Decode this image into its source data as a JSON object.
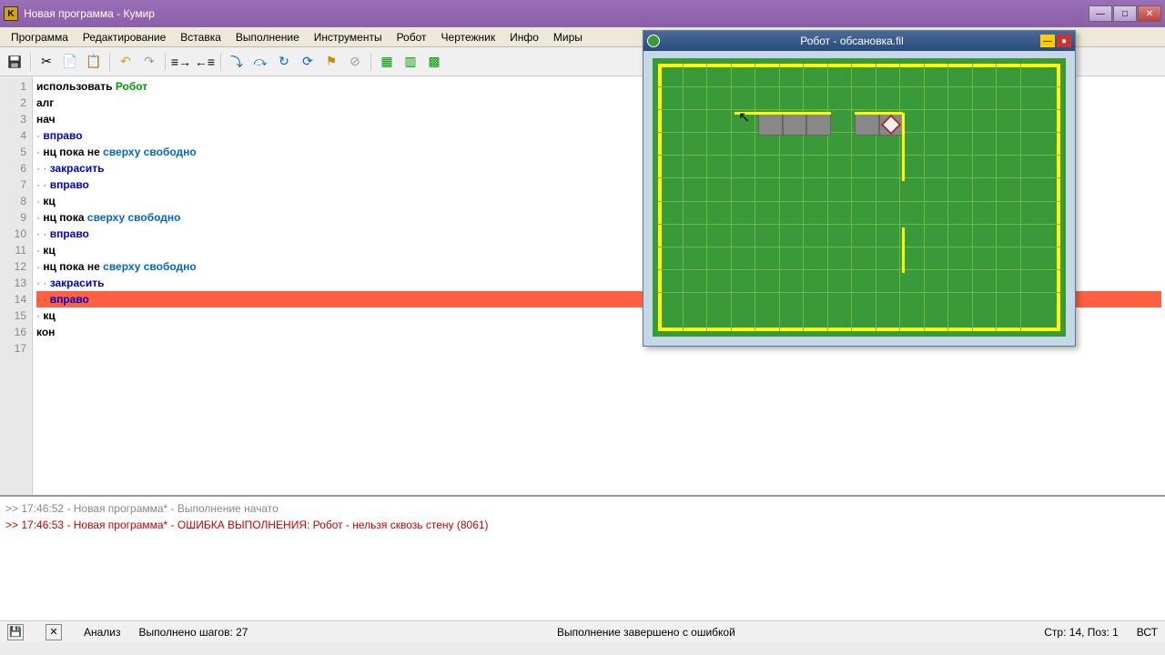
{
  "window": {
    "title": "Новая программа - Кумир"
  },
  "menu": [
    "Программа",
    "Редактирование",
    "Вставка",
    "Выполнение",
    "Инструменты",
    "Робот",
    "Чертежник",
    "Инфо",
    "Миры"
  ],
  "code": {
    "lines": [
      {
        "n": 1,
        "indent": 0,
        "tokens": [
          {
            "t": "использовать ",
            "c": "plain"
          },
          {
            "t": "Робот",
            "c": "robot"
          }
        ]
      },
      {
        "n": 2,
        "indent": 0,
        "tokens": [
          {
            "t": "алг",
            "c": "plain"
          }
        ]
      },
      {
        "n": 3,
        "indent": 0,
        "tokens": [
          {
            "t": "нач",
            "c": "plain"
          }
        ]
      },
      {
        "n": 4,
        "indent": 0,
        "dot": true,
        "tokens": [
          {
            "t": "вправо",
            "c": "cmd"
          }
        ]
      },
      {
        "n": 5,
        "indent": 0,
        "dot": true,
        "tokens": [
          {
            "t": "нц пока не ",
            "c": "plain"
          },
          {
            "t": "сверху свободно",
            "c": "cond"
          }
        ]
      },
      {
        "n": 6,
        "indent": 1,
        "dot": true,
        "tokens": [
          {
            "t": "закрасить",
            "c": "cmd"
          }
        ]
      },
      {
        "n": 7,
        "indent": 1,
        "dot": true,
        "tokens": [
          {
            "t": "вправо",
            "c": "cmd"
          }
        ]
      },
      {
        "n": 8,
        "indent": 0,
        "dot": true,
        "tokens": [
          {
            "t": "кц",
            "c": "plain"
          }
        ]
      },
      {
        "n": 9,
        "indent": 0,
        "dot": true,
        "tokens": [
          {
            "t": "нц пока ",
            "c": "plain"
          },
          {
            "t": "сверху свободно",
            "c": "cond"
          }
        ]
      },
      {
        "n": 10,
        "indent": 1,
        "dot": true,
        "tokens": [
          {
            "t": "вправо",
            "c": "cmd"
          }
        ]
      },
      {
        "n": 11,
        "indent": 0,
        "dot": true,
        "tokens": [
          {
            "t": "кц",
            "c": "plain"
          }
        ]
      },
      {
        "n": 12,
        "indent": 0,
        "dot": true,
        "tokens": [
          {
            "t": "нц пока не ",
            "c": "plain"
          },
          {
            "t": "сверху свободно",
            "c": "cond"
          }
        ]
      },
      {
        "n": 13,
        "indent": 1,
        "dot": true,
        "tokens": [
          {
            "t": "закрасить",
            "c": "cmd"
          }
        ]
      },
      {
        "n": 14,
        "indent": 1,
        "dot": true,
        "err": true,
        "tokens": [
          {
            "t": "вправо",
            "c": "cmd"
          }
        ]
      },
      {
        "n": 15,
        "indent": 0,
        "dot": true,
        "tokens": [
          {
            "t": "кц",
            "c": "plain"
          }
        ]
      },
      {
        "n": 16,
        "indent": 0,
        "tokens": [
          {
            "t": "кон",
            "c": "plain"
          }
        ]
      },
      {
        "n": 17,
        "indent": 0,
        "tokens": []
      }
    ]
  },
  "console": [
    {
      "type": "ok",
      "text": ">> 17:46:52 - Новая программа* - Выполнение начато"
    },
    {
      "type": "err",
      "text": ">> 17:46:53 - Новая программа* - ОШИБКА ВЫПОЛНЕНИЯ: Робот - нельзя сквозь стену  (8061)"
    }
  ],
  "status": {
    "analysis": "Анализ",
    "steps": "Выполнено шагов: 27",
    "result": "Выполнение завершено с ошибкой",
    "pos": "Стр: 14, Поз: 1",
    "mode": "ВСТ"
  },
  "robot": {
    "title": "Робот - обсановка.fil",
    "cols": 16,
    "rows": 11,
    "painted": [
      {
        "c": 4,
        "r": 2
      },
      {
        "c": 5,
        "r": 2
      },
      {
        "c": 6,
        "r": 2
      },
      {
        "c": 8,
        "r": 2
      },
      {
        "c": 9,
        "r": 2
      }
    ],
    "robot_pos": {
      "c": 9,
      "r": 2
    },
    "walls": [
      {
        "type": "h",
        "c1": 3,
        "c2": 7,
        "r": 2
      },
      {
        "type": "h",
        "c1": 8,
        "c2": 10,
        "r": 2
      },
      {
        "type": "v",
        "c": 10,
        "r1": 2,
        "r2": 5
      },
      {
        "type": "v",
        "c": 10,
        "r1": 7,
        "r2": 9
      }
    ]
  }
}
